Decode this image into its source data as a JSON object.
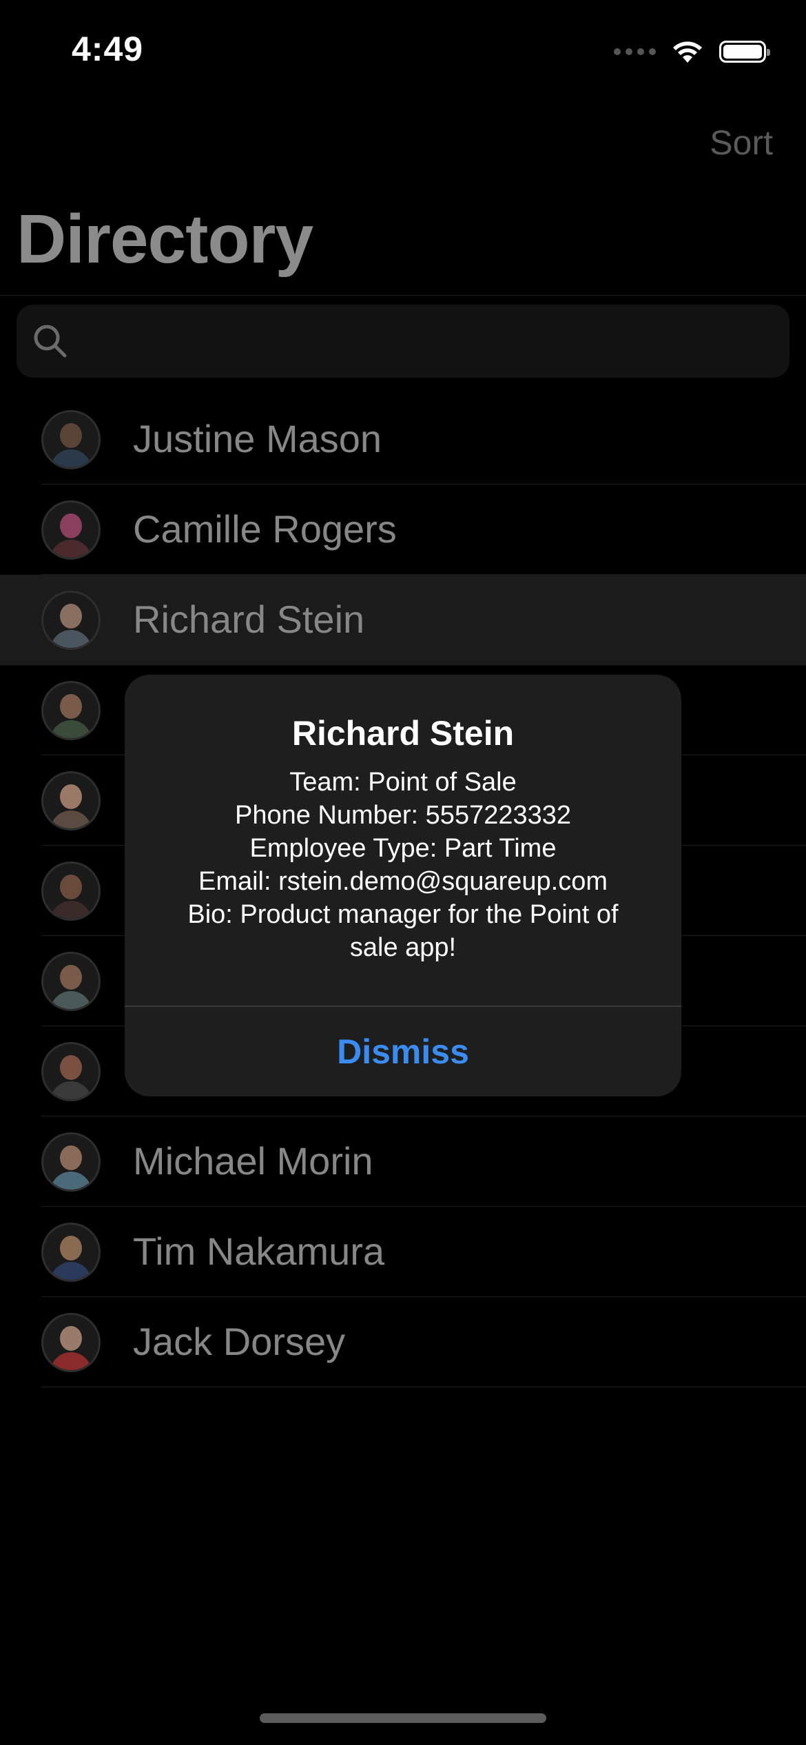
{
  "status_bar": {
    "time": "4:49"
  },
  "nav": {
    "sort_label": "Sort",
    "title": "Directory"
  },
  "search": {
    "placeholder": ""
  },
  "employees": [
    {
      "name": "Justine Mason",
      "avatar_colors": [
        "#5a4438",
        "#2b3a4a"
      ]
    },
    {
      "name": "Camille Rogers",
      "avatar_colors": [
        "#8a3f5e",
        "#4a2a2a"
      ]
    },
    {
      "name": "Richard Stein",
      "avatar_colors": [
        "#8a6f60",
        "#4a5560"
      ],
      "selected": true
    },
    {
      "name": "",
      "avatar_colors": [
        "#7a5a48",
        "#3b4b3a"
      ]
    },
    {
      "name": "",
      "avatar_colors": [
        "#9a7a66",
        "#5a4a3f"
      ]
    },
    {
      "name": "",
      "avatar_colors": [
        "#6a4a3a",
        "#3a2a2a"
      ]
    },
    {
      "name": "",
      "avatar_colors": [
        "#7a5a48",
        "#4a5a5a"
      ]
    },
    {
      "name": "",
      "avatar_colors": [
        "#7a5040",
        "#3a3a3a"
      ]
    },
    {
      "name": "Michael Morin",
      "avatar_colors": [
        "#8a6a58",
        "#4a6a7a"
      ]
    },
    {
      "name": "Tim Nakamura",
      "avatar_colors": [
        "#8a6a50",
        "#2a3a5a"
      ]
    },
    {
      "name": "Jack Dorsey",
      "avatar_colors": [
        "#9a7a68",
        "#8a2a2a"
      ]
    }
  ],
  "alert": {
    "title": "Richard Stein",
    "lines": [
      "Team: Point of Sale",
      "Phone Number: 5557223332",
      "Employee Type: Part Time",
      "Email: rstein.demo@squareup.com",
      "Bio: Product manager for the Point of",
      "sale app!"
    ],
    "dismiss_label": "Dismiss"
  },
  "colors": {
    "accent": "#3b8cf0",
    "background": "#000000"
  }
}
